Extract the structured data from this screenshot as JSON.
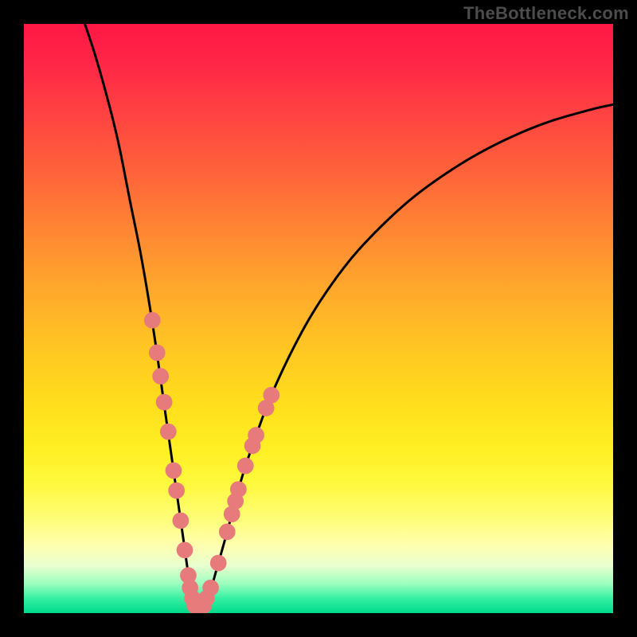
{
  "watermark": "TheBottleneck.com",
  "bg": {
    "stops": [
      {
        "t": 0.0,
        "color": "#ff1844"
      },
      {
        "t": 0.07,
        "color": "#ff2746"
      },
      {
        "t": 0.16,
        "color": "#ff4541"
      },
      {
        "t": 0.25,
        "color": "#ff623a"
      },
      {
        "t": 0.35,
        "color": "#ff8633"
      },
      {
        "t": 0.45,
        "color": "#ffa82b"
      },
      {
        "t": 0.55,
        "color": "#ffc623"
      },
      {
        "t": 0.64,
        "color": "#ffdd1c"
      },
      {
        "t": 0.72,
        "color": "#ffef23"
      },
      {
        "t": 0.78,
        "color": "#fff93d"
      },
      {
        "t": 0.84,
        "color": "#fffd78"
      },
      {
        "t": 0.885,
        "color": "#ffffb0"
      },
      {
        "t": 0.92,
        "color": "#e8ffcf"
      },
      {
        "t": 0.95,
        "color": "#9cffbe"
      },
      {
        "t": 0.975,
        "color": "#35f0a2"
      },
      {
        "t": 1.0,
        "color": "#00db8b"
      }
    ]
  },
  "chart_data": {
    "type": "line",
    "title": "",
    "xlabel": "",
    "ylabel": "",
    "xlim": [
      0,
      100
    ],
    "ylim": [
      0,
      100
    ],
    "grid": false,
    "legend": false,
    "series": [
      {
        "name": "bottleneck_curve",
        "color": "#000000",
        "x": [
          10,
          12,
          14,
          16,
          18,
          20,
          22,
          24,
          25,
          26,
          27,
          27.7,
          28.3,
          28.9,
          29.5,
          30.2,
          31.0,
          32.0,
          33.0,
          34.0,
          35.5,
          37.0,
          39.0,
          42.0,
          46.0,
          50.0,
          55.0,
          60.0,
          66.0,
          73.0,
          80.0,
          88.0,
          96.0,
          100.0
        ],
        "values": [
          101,
          95,
          88,
          80,
          70,
          60,
          48,
          34,
          27,
          20,
          13,
          8.0,
          4.0,
          2.0,
          0.9,
          0.9,
          2.5,
          5.0,
          8.5,
          12.0,
          17.5,
          23.0,
          29.0,
          37.0,
          45.5,
          52.5,
          59.5,
          65.0,
          70.5,
          75.5,
          79.5,
          83.0,
          85.4,
          86.3
        ]
      }
    ],
    "markers": {
      "name": "highlighted_points",
      "color": "#e77a7a",
      "radius_frac": 0.014,
      "points": [
        {
          "x": 21.8,
          "y": 49.7
        },
        {
          "x": 22.6,
          "y": 44.2
        },
        {
          "x": 23.2,
          "y": 40.2
        },
        {
          "x": 23.8,
          "y": 35.8
        },
        {
          "x": 24.5,
          "y": 30.8
        },
        {
          "x": 25.4,
          "y": 24.2
        },
        {
          "x": 25.9,
          "y": 20.8
        },
        {
          "x": 26.6,
          "y": 15.7
        },
        {
          "x": 27.3,
          "y": 10.7
        },
        {
          "x": 27.9,
          "y": 6.4
        },
        {
          "x": 28.2,
          "y": 4.3
        },
        {
          "x": 28.6,
          "y": 2.5
        },
        {
          "x": 29.0,
          "y": 1.3
        },
        {
          "x": 29.5,
          "y": 0.9
        },
        {
          "x": 30.0,
          "y": 0.9
        },
        {
          "x": 30.5,
          "y": 1.3
        },
        {
          "x": 31.0,
          "y": 2.5
        },
        {
          "x": 31.7,
          "y": 4.3
        },
        {
          "x": 33.0,
          "y": 8.5
        },
        {
          "x": 34.5,
          "y": 13.8
        },
        {
          "x": 35.3,
          "y": 16.8
        },
        {
          "x": 35.9,
          "y": 19.0
        },
        {
          "x": 36.4,
          "y": 21.0
        },
        {
          "x": 37.6,
          "y": 25.0
        },
        {
          "x": 38.8,
          "y": 28.4
        },
        {
          "x": 39.4,
          "y": 30.2
        },
        {
          "x": 41.1,
          "y": 34.8
        },
        {
          "x": 42.0,
          "y": 37.0
        }
      ]
    }
  }
}
